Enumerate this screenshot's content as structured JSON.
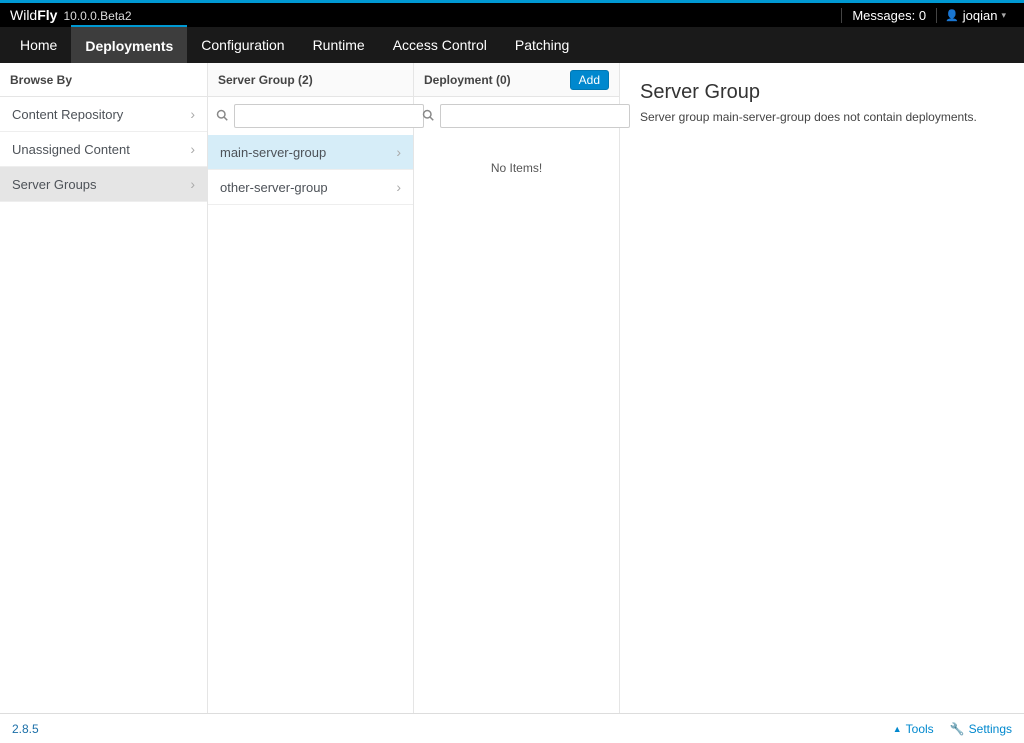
{
  "brand": {
    "name_part1": "Wild",
    "name_part2": "Fly",
    "version": "10.0.0.Beta2"
  },
  "topbar": {
    "messages_label": "Messages:",
    "messages_count": "0",
    "username": "joqian"
  },
  "nav": {
    "items": [
      "Home",
      "Deployments",
      "Configuration",
      "Runtime",
      "Access Control",
      "Patching"
    ],
    "active_index": 1
  },
  "browse": {
    "header": "Browse By",
    "items": [
      "Content Repository",
      "Unassigned Content",
      "Server Groups"
    ],
    "selected_index": 2
  },
  "server_group": {
    "header": "Server Group (2)",
    "items": [
      "main-server-group",
      "other-server-group"
    ],
    "selected_index": 0
  },
  "deployment": {
    "header": "Deployment (0)",
    "add_label": "Add",
    "no_items": "No Items!"
  },
  "detail": {
    "title": "Server Group",
    "text": "Server group main-server-group does not contain deployments."
  },
  "footer": {
    "version": "2.8.5",
    "tools": "Tools",
    "settings": "Settings"
  }
}
